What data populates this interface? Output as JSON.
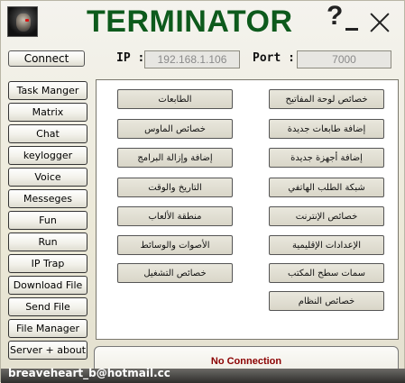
{
  "header": {
    "title": "TERMINATOR",
    "help_glyph": "?",
    "logo_icon": "terminator-face-icon"
  },
  "connection": {
    "connect_label": "Connect",
    "ip_label": "IP :",
    "ip_value": "192.168.1.106",
    "port_label": "Port :",
    "port_value": "7000"
  },
  "sidebar": {
    "items": [
      {
        "label": "Task Manger"
      },
      {
        "label": "Matrix"
      },
      {
        "label": "Chat"
      },
      {
        "label": "keylogger"
      },
      {
        "label": "Voice"
      },
      {
        "label": "Messeges"
      },
      {
        "label": "Fun"
      },
      {
        "label": "Run"
      },
      {
        "label": "IP Trap"
      },
      {
        "label": "Download File"
      },
      {
        "label": "Send File"
      },
      {
        "label": "File Manager"
      },
      {
        "label": "Server + about"
      }
    ]
  },
  "actions": {
    "left": [
      {
        "label": "الطابعات"
      },
      {
        "label": "خصائص الماوس"
      },
      {
        "label": "إضافة وإزالة البرامج"
      },
      {
        "label": "التاريخ والوقت"
      },
      {
        "label": "منطقة الألعاب"
      },
      {
        "label": "الأصوات والوسائط"
      },
      {
        "label": "خصائص التشغيل"
      }
    ],
    "right": [
      {
        "label": "خصائص لوحة المفاتيح"
      },
      {
        "label": "إضافة طابعات جديدة"
      },
      {
        "label": "إضافة أجهزة جديدة"
      },
      {
        "label": "شبكة الطلب الهاتفي"
      },
      {
        "label": "خصائص الإنترنت"
      },
      {
        "label": "الإعدادات الإقليمية"
      },
      {
        "label": "سمات سطح المكتب"
      },
      {
        "label": "خصائص النظام"
      }
    ]
  },
  "status": {
    "text": "No Connection",
    "color": "#8b0000"
  },
  "footer": {
    "email": "breaveheart_b@hotmail.cc"
  },
  "colors": {
    "title": "#0d5a1c",
    "background": "#ece9d8"
  }
}
